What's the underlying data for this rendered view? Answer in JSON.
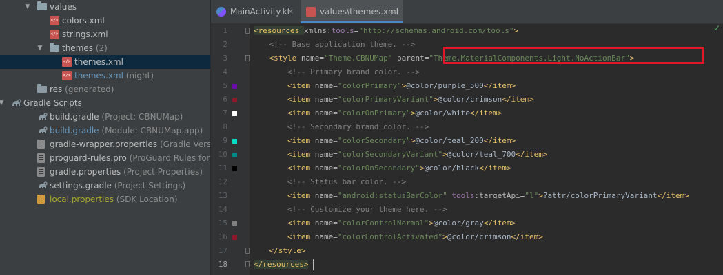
{
  "project_tree": [
    {
      "indent": 0,
      "arrow": "▼",
      "icon": "folder",
      "label": "values",
      "hint": ""
    },
    {
      "indent": 1,
      "arrow": "",
      "icon": "xml",
      "label": "colors.xml",
      "hint": ""
    },
    {
      "indent": 1,
      "arrow": "",
      "icon": "xml",
      "label": "strings.xml",
      "hint": ""
    },
    {
      "indent": 1,
      "arrow": "▼",
      "icon": "folder",
      "label": "themes",
      "hint": "(2)"
    },
    {
      "indent": 2,
      "arrow": "",
      "icon": "xml",
      "label": "themes.xml",
      "hint": "",
      "selected": true
    },
    {
      "indent": 2,
      "arrow": "",
      "icon": "xml",
      "label": "themes.xml",
      "hint": "(night)",
      "color": "blue"
    },
    {
      "indent": 0,
      "arrow": "",
      "icon": "res-folder",
      "label": "res",
      "hint": "(generated)"
    },
    {
      "indent": -1,
      "arrow": "▼",
      "icon": "gradle",
      "label": "Gradle Scripts",
      "hint": ""
    },
    {
      "indent": 0,
      "arrow": "",
      "icon": "gradle",
      "label": "build.gradle",
      "hint": "(Project: CBNUMap)"
    },
    {
      "indent": 0,
      "arrow": "",
      "icon": "gradle",
      "label": "build.gradle",
      "hint": "(Module: CBNUMap.app)",
      "color": "blue"
    },
    {
      "indent": 0,
      "arrow": "",
      "icon": "props",
      "label": "gradle-wrapper.properties",
      "hint": "(Gradle Version)"
    },
    {
      "indent": 0,
      "arrow": "",
      "icon": "props",
      "label": "proguard-rules.pro",
      "hint": "(ProGuard Rules for CBN"
    },
    {
      "indent": 0,
      "arrow": "",
      "icon": "props",
      "label": "gradle.properties",
      "hint": "(Project Properties)"
    },
    {
      "indent": 0,
      "arrow": "",
      "icon": "gradle",
      "label": "settings.gradle",
      "hint": "(Project Settings)"
    },
    {
      "indent": 0,
      "arrow": "",
      "icon": "props-orange",
      "label": "local.properties",
      "hint": "(SDK Location)",
      "color": "olive"
    }
  ],
  "tabs": [
    {
      "label": "MainActivity.kt",
      "close": "×",
      "active": false,
      "icon": "kotlin-icon"
    },
    {
      "label": "values\\themes.xml",
      "close": "×",
      "active": true,
      "icon": "xml-icon"
    }
  ],
  "status_check": "✓",
  "gutter": {
    "line_numbers": [
      "1",
      "2",
      "3",
      "4",
      "5",
      "6",
      "7",
      "8",
      "9",
      "10",
      "11",
      "12",
      "13",
      "14",
      "15",
      "16",
      "17",
      "18"
    ],
    "swatches": {
      "5": "#6a0dad",
      "6": "#8b1a2b",
      "7": "#ffffff",
      "9": "#03dac5",
      "10": "#018786",
      "11": "#000000",
      "15": "#808080",
      "16": "#8b1a2b"
    }
  },
  "code_lines": [
    [
      {
        "c": "tag",
        "t": "<resources "
      },
      {
        "c": "attr",
        "t": "xmlns:"
      },
      {
        "c": "ns",
        "t": "tools"
      },
      {
        "c": "attr",
        "t": "="
      },
      {
        "c": "str",
        "t": "\"http://schemas.android.com/tools\""
      },
      {
        "c": "tag",
        "t": ">"
      }
    ],
    [
      {
        "c": "cmt",
        "t": "    <!-- Base application theme. -->"
      }
    ],
    [
      {
        "c": "tag",
        "t": "    <style "
      },
      {
        "c": "attr",
        "t": "name="
      },
      {
        "c": "str",
        "t": "\"Theme.CBNUMap\" "
      },
      {
        "c": "attr",
        "t": "parent="
      },
      {
        "c": "str",
        "t": "\"Theme.MaterialComponents.Light.NoActionBar\""
      },
      {
        "c": "tag",
        "t": ">"
      }
    ],
    [
      {
        "c": "cmt",
        "t": "        <!-- Primary brand color. -->"
      }
    ],
    [
      {
        "c": "tag",
        "t": "        <item "
      },
      {
        "c": "attr",
        "t": "name="
      },
      {
        "c": "str",
        "t": "\"colorPrimary\""
      },
      {
        "c": "tag",
        "t": ">"
      },
      {
        "c": "",
        "t": "@color/purple_500"
      },
      {
        "c": "tag",
        "t": "</item>"
      }
    ],
    [
      {
        "c": "tag",
        "t": "        <item "
      },
      {
        "c": "attr",
        "t": "name="
      },
      {
        "c": "str",
        "t": "\"colorPrimaryVariant\""
      },
      {
        "c": "tag",
        "t": ">"
      },
      {
        "c": "",
        "t": "@color/crimson"
      },
      {
        "c": "tag",
        "t": "</item>"
      }
    ],
    [
      {
        "c": "tag",
        "t": "        <item "
      },
      {
        "c": "attr",
        "t": "name="
      },
      {
        "c": "str",
        "t": "\"colorOnPrimary\""
      },
      {
        "c": "tag",
        "t": ">"
      },
      {
        "c": "",
        "t": "@color/white"
      },
      {
        "c": "tag",
        "t": "</item>"
      }
    ],
    [
      {
        "c": "cmt",
        "t": "        <!-- Secondary brand color. -->"
      }
    ],
    [
      {
        "c": "tag",
        "t": "        <item "
      },
      {
        "c": "attr",
        "t": "name="
      },
      {
        "c": "str",
        "t": "\"colorSecondary\""
      },
      {
        "c": "tag",
        "t": ">"
      },
      {
        "c": "",
        "t": "@color/teal_200"
      },
      {
        "c": "tag",
        "t": "</item>"
      }
    ],
    [
      {
        "c": "tag",
        "t": "        <item "
      },
      {
        "c": "attr",
        "t": "name="
      },
      {
        "c": "str",
        "t": "\"colorSecondaryVariant\""
      },
      {
        "c": "tag",
        "t": ">"
      },
      {
        "c": "",
        "t": "@color/teal_700"
      },
      {
        "c": "tag",
        "t": "</item>"
      }
    ],
    [
      {
        "c": "tag",
        "t": "        <item "
      },
      {
        "c": "attr",
        "t": "name="
      },
      {
        "c": "str",
        "t": "\"colorOnSecondary\""
      },
      {
        "c": "tag",
        "t": ">"
      },
      {
        "c": "",
        "t": "@color/black"
      },
      {
        "c": "tag",
        "t": "</item>"
      }
    ],
    [
      {
        "c": "cmt",
        "t": "        <!-- Status bar color. -->"
      }
    ],
    [
      {
        "c": "tag",
        "t": "        <item "
      },
      {
        "c": "attr",
        "t": "name="
      },
      {
        "c": "str",
        "t": "\"android:statusBarColor\" "
      },
      {
        "c": "ns",
        "t": "tools"
      },
      {
        "c": "attr",
        "t": ":targetApi="
      },
      {
        "c": "str",
        "t": "\"l\""
      },
      {
        "c": "tag",
        "t": ">"
      },
      {
        "c": "",
        "t": "?attr/colorPrimaryVariant"
      },
      {
        "c": "tag",
        "t": "</item>"
      }
    ],
    [
      {
        "c": "cmt",
        "t": "        <!-- Customize your theme here. -->"
      }
    ],
    [
      {
        "c": "tag",
        "t": "        <item "
      },
      {
        "c": "attr",
        "t": "name="
      },
      {
        "c": "str",
        "t": "\"colorControlNormal\""
      },
      {
        "c": "tag",
        "t": ">"
      },
      {
        "c": "",
        "t": "@color/gray"
      },
      {
        "c": "tag",
        "t": "</item>"
      }
    ],
    [
      {
        "c": "tag",
        "t": "        <item "
      },
      {
        "c": "attr",
        "t": "name="
      },
      {
        "c": "str",
        "t": "\"colorControlActivated\""
      },
      {
        "c": "tag",
        "t": ">"
      },
      {
        "c": "",
        "t": "@color/crimson"
      },
      {
        "c": "tag",
        "t": "</item>"
      }
    ],
    [
      {
        "c": "tag",
        "t": "    </style>"
      }
    ],
    [
      {
        "c": "tag",
        "t": "</resources>"
      }
    ]
  ],
  "colors": {
    "selection": "#0d293e",
    "highlight_box": "#e3152b",
    "accent": "#4a88c7"
  }
}
